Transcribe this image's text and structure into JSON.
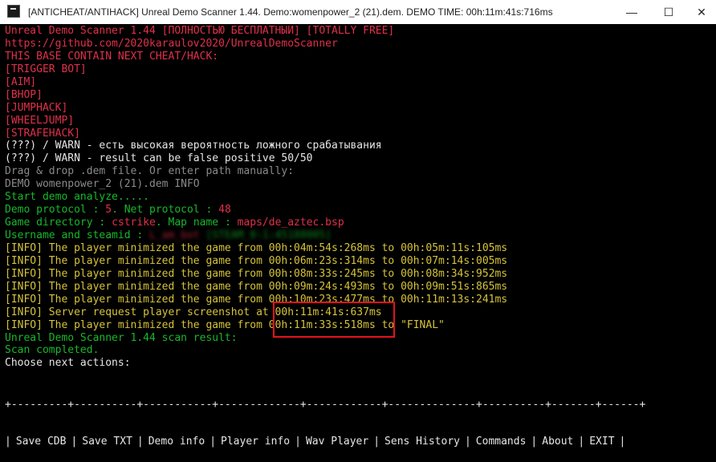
{
  "window": {
    "title": "[ANTICHEAT/ANTIHACK] Unreal Demo Scanner 1.44. Demo:womenpower_2 (21).dem. DEMO TIME: 00h:11m:41s:716ms",
    "minimize_glyph": "—",
    "maximize_glyph": "☐",
    "close_glyph": "✕"
  },
  "colors": {
    "red": "#e0304a",
    "green": "#17b82b",
    "yellow": "#d6c339",
    "highlight": "#e3131b"
  },
  "console": {
    "header_title": "Unreal Demo Scanner 1.44 [ПОЛНОСТЬЮ БЕСПЛАТНЫЙ] [TOTALLY FREE]",
    "header_url": "https://github.com/2020karaulov2020/UnrealDemoScanner",
    "cheat_intro": "THIS BASE CONTAIN NEXT CHEAT/HACK:",
    "cheats": [
      "[TRIGGER BOT]",
      "[AIM]",
      "[BHOP]",
      "[JUMPHACK]",
      "[WHEELJUMP]",
      "[STRAFEHACK]"
    ],
    "warn_ru": "(???) / WARN - есть высокая вероятность ложного срабатывания",
    "warn_en": "(???) / WARN - result can be false positive 50/50",
    "drag_drop": "Drag & drop .dem file. Or enter path manually:",
    "demo_info": "DEMO womenpower_2 (21).dem INFO",
    "start_analyze": "Start demo analyze.....",
    "protocol_label": "Demo protocol : ",
    "protocol_value": "5",
    "net_protocol_label": ". Net protocol : ",
    "net_protocol_value": "48",
    "game_dir_label": "Game directory : ",
    "game_dir_value": "cstrike",
    "map_label": ". Map name : ",
    "map_value": "maps/de_aztec.bsp",
    "username_label": "Username and steamid : ",
    "username_value": "L_am_bot",
    "steamid_value": "[STEAM_0:1:45188005]",
    "info_lines": [
      "[INFO] The player minimized the game from 00h:04m:54s:268ms to 00h:05m:11s:105ms",
      "[INFO] The player minimized the game from 00h:06m:23s:314ms to 00h:07m:14s:005ms",
      "[INFO] The player minimized the game from 00h:08m:33s:245ms to 00h:08m:34s:952ms",
      "[INFO] The player minimized the game from 00h:09m:24s:493ms to 00h:09m:51s:865ms",
      "[INFO] The player minimized the game from 00h:10m:23s:477ms to 00h:11m:13s:241ms",
      "[INFO] Server request player screenshot at 00h:11m:41s:637ms",
      "[INFO] The player minimized the game from 00h:11m:33s:518ms to \"FINAL\""
    ],
    "scan_result": "Unreal Demo Scanner 1.44 scan result:",
    "scan_completed": "Scan completed.",
    "choose_actions": "Choose next actions:"
  },
  "menu": {
    "border_line": "+---------+----------+-----------+-------------+------------+--------------+----------+-------+------+",
    "items": [
      "Save CDB",
      "Save TXT",
      "Demo info",
      "Player info",
      "Wav Player",
      "Sens History",
      "Commands",
      "About",
      "EXIT"
    ]
  }
}
